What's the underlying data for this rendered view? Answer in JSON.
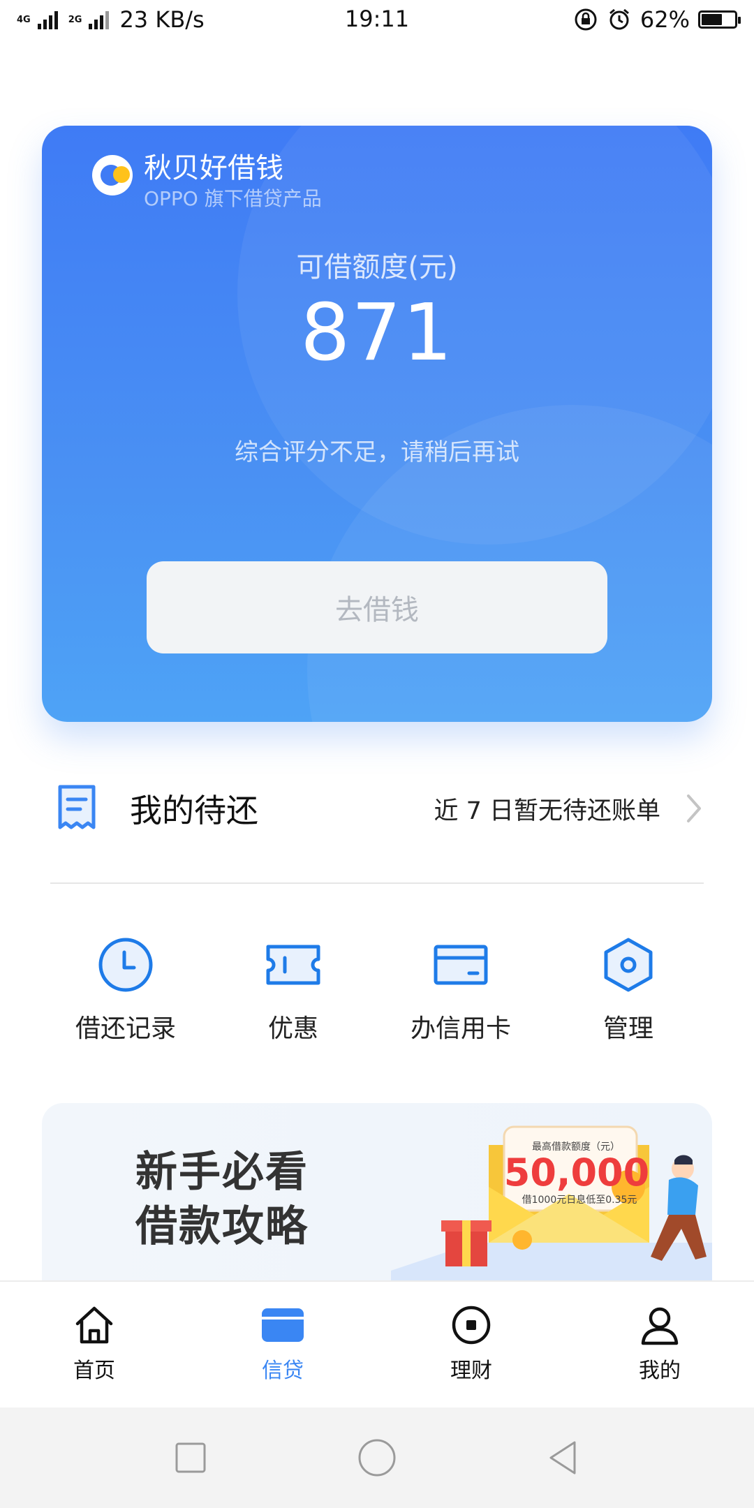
{
  "status_bar": {
    "network_1": "4G",
    "network_2": "2G",
    "speed": "23 KB/s",
    "time": "19:11",
    "battery": "62%",
    "battery_level": 0.62
  },
  "hero": {
    "brand_name": "秋贝好借钱",
    "brand_sub": "OPPO 旗下借贷产品",
    "quota_label": "可借额度(元)",
    "quota_value": "871",
    "note": "综合评分不足，请稍后再试",
    "borrow_button": "去借钱"
  },
  "pending": {
    "title": "我的待还",
    "status": "近 7 日暂无待还账单"
  },
  "actions": [
    {
      "label": "借还记录",
      "icon": "clock-icon"
    },
    {
      "label": "优惠",
      "icon": "coupon-icon"
    },
    {
      "label": "办信用卡",
      "icon": "credit-card-icon"
    },
    {
      "label": "管理",
      "icon": "hexagon-settings-icon"
    }
  ],
  "banner": {
    "title_line1": "新手必看",
    "title_line2": "借款攻略",
    "amount_label": "最高借款额度（元）",
    "amount": "50,000",
    "amount_note": "借1000元日息低至0.35元"
  },
  "tabbar": {
    "items": [
      {
        "label": "首页",
        "icon": "home-icon",
        "active": false
      },
      {
        "label": "信贷",
        "icon": "card-icon",
        "active": true
      },
      {
        "label": "理财",
        "icon": "finance-icon",
        "active": false
      },
      {
        "label": "我的",
        "icon": "person-icon",
        "active": false
      }
    ]
  },
  "colors": {
    "accent": "#3a86f3",
    "hero_top": "#3f7bf5",
    "hero_bottom": "#4ea3f6",
    "banner_amount": "#ee3d3d"
  }
}
